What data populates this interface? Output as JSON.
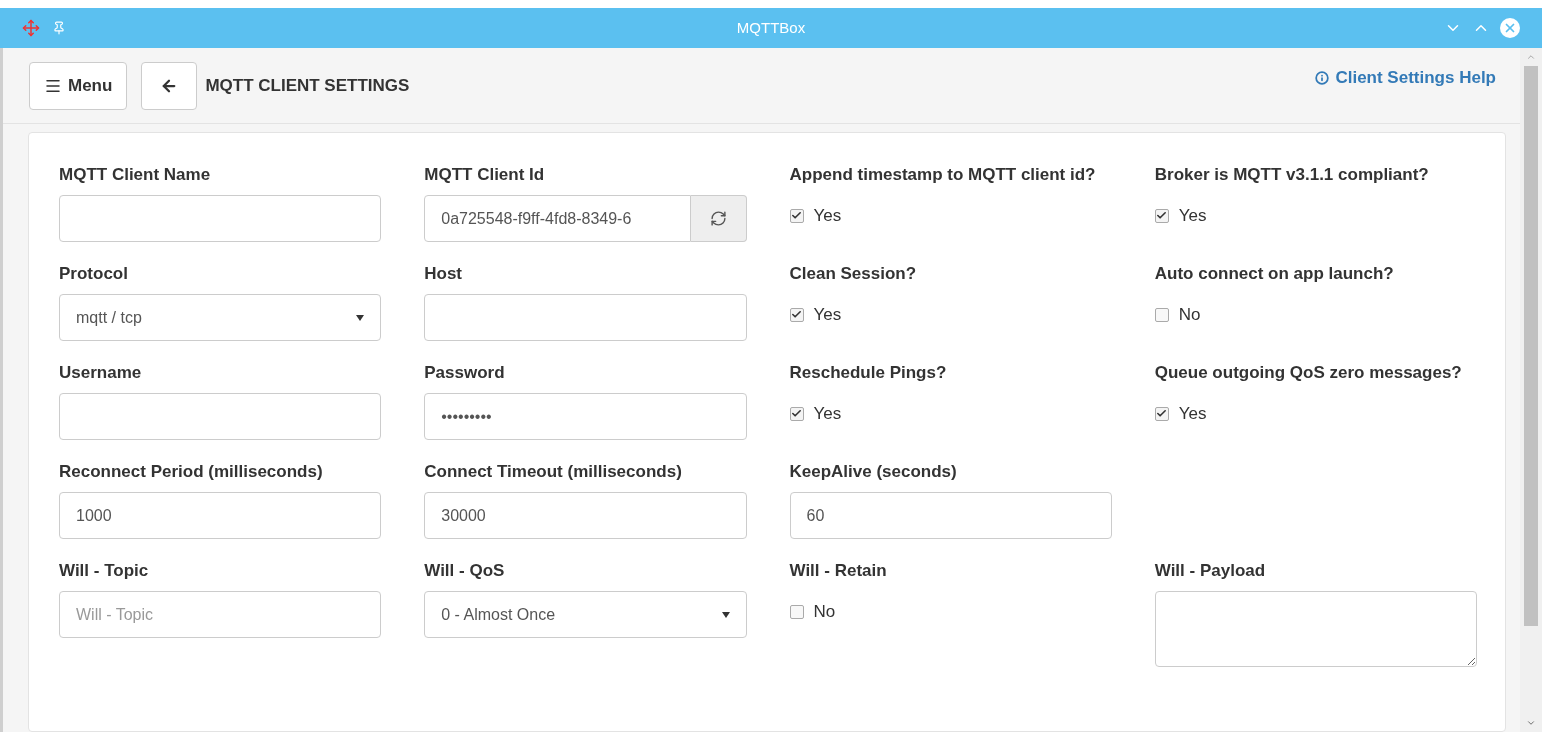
{
  "window": {
    "title": "MQTTBox"
  },
  "toolbar": {
    "menu_button": "Menu",
    "page_title": "MQTT CLIENT SETTINGS",
    "help_link": "Client Settings Help"
  },
  "fields": [
    {
      "kind": "text",
      "label": "MQTT Client Name"
    },
    {
      "kind": "text_button",
      "label": "MQTT Client Id",
      "value": "0a725548-f9ff-4fd8-8349-6"
    },
    {
      "kind": "checkbox",
      "label": "Append timestamp to MQTT client id?",
      "option": "Yes",
      "checked": true
    },
    {
      "kind": "checkbox",
      "label": "Broker is MQTT v3.1.1 compliant?",
      "option": "Yes",
      "checked": true
    },
    {
      "kind": "select",
      "label": "Protocol",
      "value": "mqtt / tcp"
    },
    {
      "kind": "text",
      "label": "Host"
    },
    {
      "kind": "checkbox",
      "label": "Clean Session?",
      "option": "Yes",
      "checked": true
    },
    {
      "kind": "checkbox",
      "label": "Auto connect on app launch?",
      "option": "No",
      "checked": false
    },
    {
      "kind": "text",
      "label": "Username"
    },
    {
      "kind": "text",
      "label": "Password",
      "value": "•••••••••"
    },
    {
      "kind": "checkbox",
      "label": "Reschedule Pings?",
      "option": "Yes",
      "checked": true
    },
    {
      "kind": "checkbox",
      "label": "Queue outgoing QoS zero messages?",
      "option": "Yes",
      "checked": true
    },
    {
      "kind": "text",
      "label": "Reconnect Period (milliseconds)",
      "value": "1000"
    },
    {
      "kind": "text",
      "label": "Connect Timeout (milliseconds)",
      "value": "30000"
    },
    {
      "kind": "text",
      "label": "KeepAlive (seconds)",
      "value": "60"
    },
    {
      "kind": "empty"
    },
    {
      "kind": "text",
      "label": "Will - Topic",
      "placeholder": "Will - Topic"
    },
    {
      "kind": "select",
      "label": "Will - QoS",
      "value": "0 - Almost Once"
    },
    {
      "kind": "checkbox",
      "label": "Will - Retain",
      "option": "No",
      "checked": false
    },
    {
      "kind": "textarea",
      "label": "Will - Payload"
    }
  ]
}
